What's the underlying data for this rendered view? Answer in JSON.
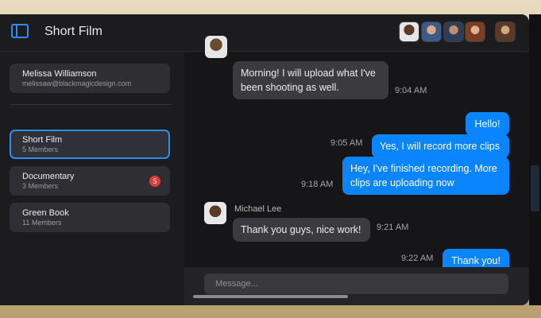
{
  "header": {
    "title": "Short Film"
  },
  "user": {
    "name": "Melissa Williamson",
    "email": "melissaw@blackmagicdesign.com"
  },
  "groups": [
    {
      "name": "Short Film",
      "members": "5 Members",
      "active": true,
      "badge": ""
    },
    {
      "name": "Documentary",
      "members": "3 Members",
      "active": false,
      "badge": "5"
    },
    {
      "name": "Green Book",
      "members": "11 Members",
      "active": false,
      "badge": ""
    }
  ],
  "messages": [
    {
      "side": "in",
      "text": "Morning! I will upload what I've been shooting as well.",
      "time": "9:04 AM"
    },
    {
      "side": "out",
      "text": "Hello!",
      "time": ""
    },
    {
      "side": "out",
      "text": "Yes, I will record more clips",
      "time": "9:05 AM"
    },
    {
      "side": "out",
      "text": "Hey, I've finished recording. More clips are uploading now",
      "time": "9:18 AM"
    },
    {
      "side": "in",
      "sender": "Michael Lee",
      "text": "Thank you guys, nice work!",
      "time": "9:21 AM"
    },
    {
      "side": "out",
      "text": "Thank you!",
      "time": "9:22 AM"
    }
  ],
  "composer": {
    "placeholder": "Message..."
  },
  "colors": {
    "accent": "#0a84ff",
    "badge": "#e03a3a"
  }
}
